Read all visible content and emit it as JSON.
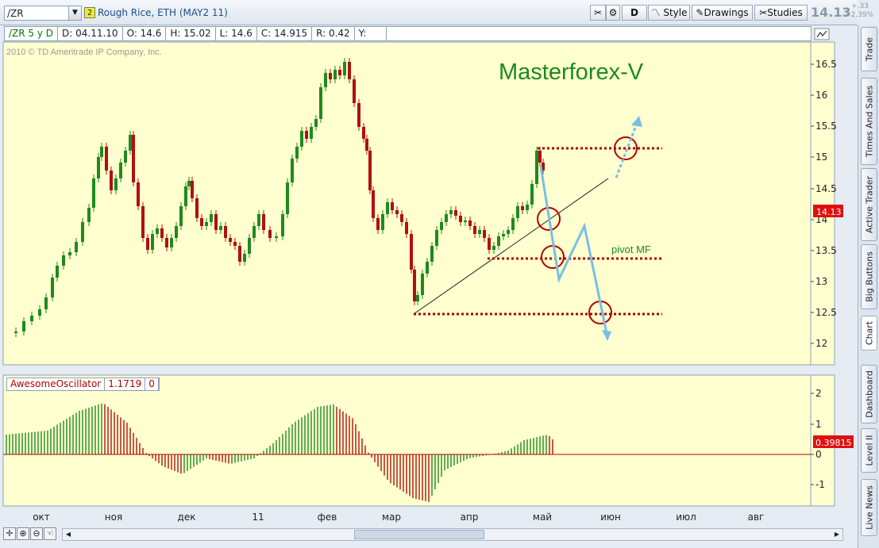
{
  "toolbar": {
    "symbol": "/ZR",
    "group": "2",
    "description": "Rough Rice, ETH (MAY2 11)",
    "period_label": "D",
    "style_label": "Style",
    "drawings_label": "Drawings",
    "studies_label": "Studies",
    "last": "14.13",
    "change": "+.33",
    "change_pct": "+2.39%"
  },
  "info": {
    "symbol_period": "/ZR 5 y D",
    "date": "D: 04.11.10",
    "open": "O: 14.6",
    "high": "H: 15.02",
    "low": "L: 14.6",
    "close": "C: 14.915",
    "range": "R: 0.42",
    "y": "Y:"
  },
  "chart": {
    "copyright": "2010 © TD Ameritrade IP Company, Inc.",
    "watermark": "Masterforex-V",
    "pivot_label": "pivot MF",
    "price_ticks": [
      "16.5",
      "16",
      "15.5",
      "15",
      "14.5",
      "14",
      "13.5",
      "13",
      "12.5",
      "12"
    ],
    "price_tag": "14.13",
    "x_ticks": [
      "окт",
      "ноя",
      "дек",
      "11",
      "фев",
      "мар",
      "апр",
      "май",
      "июн",
      "июл",
      "авг"
    ]
  },
  "oscillator": {
    "name": "AwesomeOscillator",
    "value": "1.1719",
    "extra": "0",
    "ticks": [
      "2",
      "1",
      "0",
      "-1"
    ],
    "value_tag": "0.39815"
  },
  "sidebar": {
    "tabs": [
      "Trade",
      "Times And Sales",
      "Active Trader",
      "Big Buttons",
      "Chart",
      "Dashboard",
      "Level II",
      "Live News"
    ]
  },
  "colors": {
    "up": "#1e8a1e",
    "down": "#b01010",
    "chart_bg": "#ffffcf",
    "annotation": "#b00000",
    "arrow": "#6eb8e0"
  }
}
